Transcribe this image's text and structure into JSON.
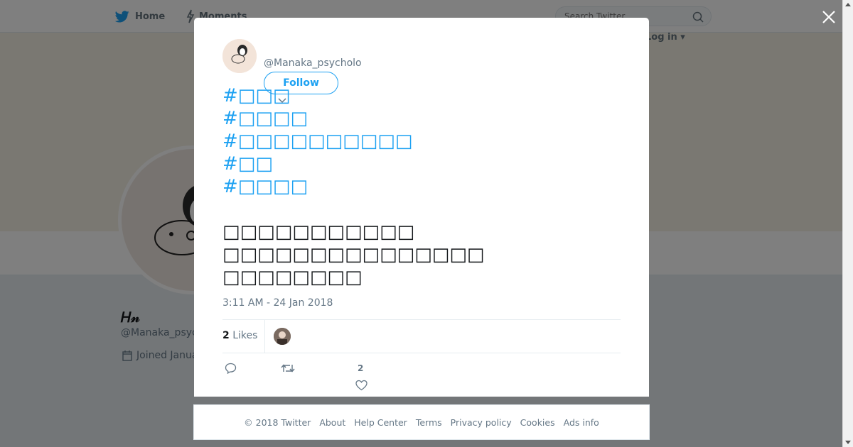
{
  "topbar": {
    "home_label": "Home",
    "moments_label": "Moments",
    "search_placeholder": "Search Twitter",
    "login_label": "Log in"
  },
  "profile": {
    "name": "𝐻𝓃",
    "handle": "@Manaka_psycholo",
    "handle_short": "@Manaka_psyc",
    "joined": "Joined Janua"
  },
  "tweet": {
    "handle": "@Manaka_psycholo",
    "follow_label": "Follow",
    "hashtags": [
      "#□□□",
      "#□□□□",
      "#□□□□□□□□□□",
      "#□□",
      "#□□□□"
    ],
    "lines": [
      "□□□□□□□□□□□",
      "□□□□□□□□□□□□□□□",
      "□□□□□□□□"
    ],
    "timestamp": "3:11 AM - 24 Jan 2018",
    "likes_count": "2",
    "likes_label": "Likes",
    "like_action_count": "2"
  },
  "footer": {
    "links": [
      "© 2018 Twitter",
      "About",
      "Help Center",
      "Terms",
      "Privacy policy",
      "Cookies",
      "Ads info"
    ]
  },
  "icons": {
    "brand": "twitter-bird-icon",
    "moments": "lightning-icon",
    "search": "search-icon",
    "close": "close-icon",
    "reply": "reply-icon",
    "retweet": "retweet-icon",
    "like": "heart-icon",
    "calendar": "calendar-icon"
  },
  "colors": {
    "accent": "#1da1f2",
    "text": "#14171a",
    "muted": "#657786",
    "banner": "#f4f1e5"
  }
}
